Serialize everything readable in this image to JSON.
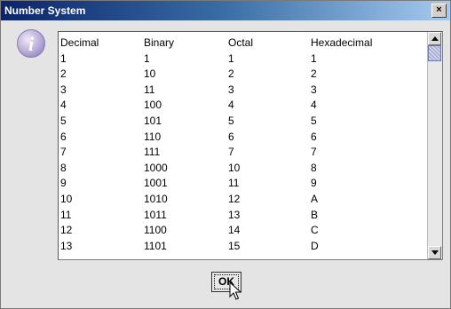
{
  "dialog": {
    "title": "Number System",
    "close_glyph": "×",
    "icon": "information-icon",
    "ok_label": "OK"
  },
  "table": {
    "headers": [
      "Decimal",
      "Binary",
      "Octal",
      "Hexadecimal"
    ],
    "rows": [
      [
        "1",
        "1",
        "1",
        "1"
      ],
      [
        "2",
        "10",
        "2",
        "2"
      ],
      [
        "3",
        "11",
        "3",
        "3"
      ],
      [
        "4",
        "100",
        "4",
        "4"
      ],
      [
        "5",
        "101",
        "5",
        "5"
      ],
      [
        "6",
        "110",
        "6",
        "6"
      ],
      [
        "7",
        "111",
        "7",
        "7"
      ],
      [
        "8",
        "1000",
        "10",
        "8"
      ],
      [
        "9",
        "1001",
        "11",
        "9"
      ],
      [
        "10",
        "1010",
        "12",
        "A"
      ],
      [
        "11",
        "1011",
        "13",
        "B"
      ],
      [
        "12",
        "1100",
        "14",
        "C"
      ],
      [
        "13",
        "1101",
        "15",
        "D"
      ]
    ]
  },
  "colors": {
    "title_bar_start": "#0a246a",
    "title_bar_end": "#a6caf0",
    "dialog_background": "#e4e4e4"
  }
}
